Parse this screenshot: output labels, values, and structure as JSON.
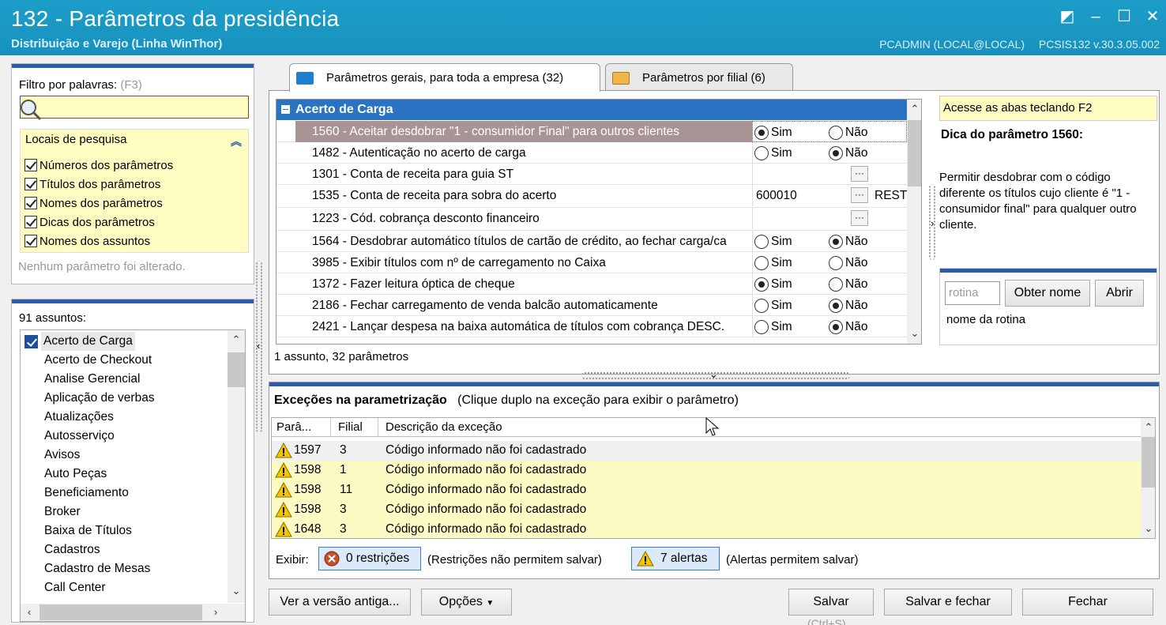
{
  "window": {
    "title": "132 - Parâmetros da presidência",
    "subtitle": "Distribuição e Varejo (Linha WinThor)",
    "user": "PCADMIN (LOCAL@LOCAL)",
    "version": "PCSIS132  v.30.3.05.002"
  },
  "filter": {
    "label": "Filtro por palavras:",
    "shortcut": "(F3)",
    "locais_title": "Locais de pesquisa",
    "options": [
      "Números dos parâmetros",
      "Títulos dos parâmetros",
      "Nomes dos parâmetros",
      "Dicas dos parâmetros",
      "Nomes dos assuntos"
    ],
    "status": "Nenhum parâmetro foi alterado."
  },
  "subjects": {
    "count": "91 assuntos:",
    "items": [
      "Acerto de Carga",
      "Acerto de Checkout",
      "Analise Gerencial",
      "Aplicação de verbas",
      "Atualizações",
      "Autosserviço",
      "Avisos",
      "Auto Peças",
      "Beneficiamento",
      "Broker",
      "Baixa de Títulos",
      "Cadastros",
      "Cadastro de Mesas",
      "Call Center"
    ]
  },
  "tabs": {
    "general": "Parâmetros gerais, para toda a empresa  (32)",
    "branch": "Parâmetros por filial  (6)"
  },
  "params": {
    "group": "Acerto de Carga",
    "sim": "Sim",
    "nao": "Não",
    "rows": [
      {
        "name": "1560 - Aceitar desdobrar \"1 - consumidor Final\" para outros clientes",
        "type": "radio",
        "value": "sim"
      },
      {
        "name": "1482 - Autenticação no acerto de carga",
        "type": "radio",
        "value": "nao"
      },
      {
        "name": "1301 - Conta de receita para guia ST",
        "type": "lookup",
        "value": "",
        "extra": ""
      },
      {
        "name": "1535 - Conta de receita para sobra do acerto",
        "type": "lookup",
        "value": "600010",
        "extra": "REST"
      },
      {
        "name": "1223 - Cód. cobrança desconto financeiro",
        "type": "lookup",
        "value": "",
        "extra": ""
      },
      {
        "name": "1564 - Desdobrar automático títulos de cartão de crédito, ao fechar carga/ca",
        "type": "radio",
        "value": "nao"
      },
      {
        "name": "3985 - Exibir títulos com nº de carregamento no Caixa",
        "type": "radio",
        "value": "none"
      },
      {
        "name": "1372 - Fazer leitura óptica de cheque",
        "type": "radio",
        "value": "sim"
      },
      {
        "name": "2186 - Fechar carregamento de venda balcão automaticamente",
        "type": "radio",
        "value": "nao"
      },
      {
        "name": "2421 - Lançar despesa na baixa automática de títulos com cobrança DESC.",
        "type": "radio",
        "value": "nao"
      }
    ],
    "footer": "1 assunto, 32 parâmetros"
  },
  "hint": {
    "top": "Acesse as abas teclando F2",
    "title": "Dica do parâmetro 1560:",
    "text": "Permitir desdobrar com o código diferente os títulos cujo cliente é \"1 - consumidor final\" para qualquer outro cliente.",
    "rotina_placeholder": "rotina",
    "get_name": "Obter nome",
    "open": "Abrir",
    "rotina_name": "nome da rotina"
  },
  "exceptions": {
    "title": "Exceções na parametrização",
    "subtitle": "(Clique duplo na exceção para exibir o parâmetro)",
    "col_param": "Parâ...",
    "col_filial": "Filial",
    "col_desc": "Descrição da exceção",
    "rows": [
      {
        "param": "1597",
        "filial": "3",
        "desc": "Código informado não foi cadastrado"
      },
      {
        "param": "1598",
        "filial": "1",
        "desc": "Código informado não foi cadastrado"
      },
      {
        "param": "1598",
        "filial": "11",
        "desc": "Código informado não foi cadastrado"
      },
      {
        "param": "1598",
        "filial": "3",
        "desc": "Código informado não foi cadastrado"
      },
      {
        "param": "1648",
        "filial": "3",
        "desc": "Código informado não foi cadastrado"
      }
    ],
    "exibir": "Exibir:",
    "restricoes_btn": "0 restrições",
    "restricoes_note": "(Restrições não permitem salvar)",
    "alertas_btn": "7 alertas",
    "alertas_note": "(Alertas permitem salvar)"
  },
  "buttons": {
    "old_version": "Ver a versão antiga...",
    "options": "Opções",
    "save": "Salvar",
    "save_shortcut": "(Ctrl+S)",
    "save_close": "Salvar e fechar",
    "close": "Fechar"
  },
  "colors": {
    "titlebar": "#1791bd",
    "accent": "#2a73c2",
    "hint_bg": "#fefcc0",
    "selected_row": "#a89494"
  }
}
